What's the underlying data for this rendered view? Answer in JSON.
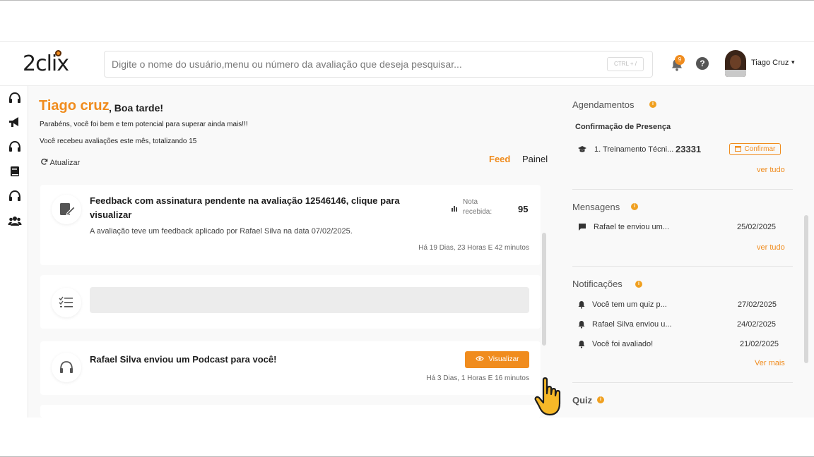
{
  "header": {
    "logo": "2clix",
    "search_placeholder": "Digite o nome do usuário,menu ou número da avaliação que deseja pesquisar...",
    "search_shortcut": "CTRL + /",
    "notification_count": "9",
    "help_icon": "?",
    "user_name": "Tiago Cruz",
    "user_caret": "▾"
  },
  "sidebar": {
    "icons": [
      "headset-icon",
      "megaphone-icon",
      "headset-icon",
      "book-icon",
      "headset-icon",
      "group-icon"
    ]
  },
  "greeting": {
    "name": "Tiago cruz",
    "rest": ", Boa tarde!",
    "line1": "Parabéns, você foi bem e tem potencial para superar ainda mais!!!",
    "line2": "Você recebeu avaliações este mês, totalizando 15",
    "refresh_label": "Atualizar"
  },
  "tabs": {
    "feed": "Feed",
    "painel": "Painel"
  },
  "feed": {
    "card1": {
      "title": "Feedback com assinatura pendente na avaliação 12546146, clique para visualizar",
      "desc": "A avaliação teve um feedback aplicado por Rafael Silva na data 07/02/2025.",
      "nota_label": "Nota recebida:",
      "nota_value": "95",
      "time": "Há 19 Dias, 23 Horas E 42 minutos"
    },
    "card3": {
      "title": "Rafael Silva enviou um Podcast para você!",
      "button": "Visualizar",
      "time": "Há 3 Dias, 1 Horas E 16 minutos"
    }
  },
  "agendamentos": {
    "title": "Agendamentos",
    "subtitle": "Confirmação de Presença",
    "item_text": "1. Treinamento Técni...",
    "item_code": "23331",
    "confirm": "Confirmar",
    "link": "ver tudo"
  },
  "mensagens": {
    "title": "Mensagens",
    "items": [
      {
        "text": "Rafael te enviou um...",
        "date": "25/02/2025"
      }
    ],
    "link": "ver tudo"
  },
  "notificacoes": {
    "title": "Notificações",
    "items": [
      {
        "text": "Você tem um quiz p...",
        "date": "27/02/2025"
      },
      {
        "text": "Rafael Silva enviou u...",
        "date": "24/02/2025"
      },
      {
        "text": "Você foi avaliado!",
        "date": "21/02/2025"
      }
    ],
    "link": "Ver mais"
  },
  "quiz": {
    "title": "Quiz"
  },
  "colors": {
    "accent": "#f08c1e",
    "text": "#1d1d1d",
    "panel": "#f9f9f9"
  }
}
